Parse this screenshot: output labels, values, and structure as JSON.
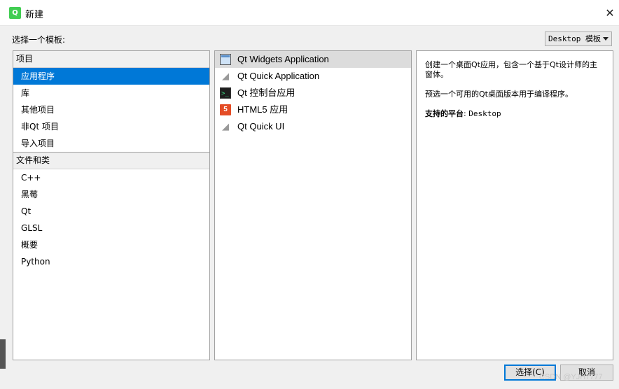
{
  "window": {
    "title": "新建"
  },
  "header": {
    "choose_template_label": "选择一个模板:"
  },
  "platform_combo": {
    "value": "Desktop 模板"
  },
  "categories": {
    "projects_header": "项目",
    "projects": [
      "应用程序",
      "库",
      "其他项目",
      "非Qt 项目",
      "导入项目"
    ],
    "files_header": "文件和类",
    "files": [
      "C++",
      "黑莓",
      "Qt",
      "GLSL",
      "概要",
      "Python"
    ]
  },
  "templates": [
    {
      "label": "Qt Widgets Application",
      "icon": "widgets-window-icon"
    },
    {
      "label": "Qt Quick Application",
      "icon": "qt-quick-icon"
    },
    {
      "label": "Qt 控制台应用",
      "icon": "console-icon"
    },
    {
      "label": "HTML5 应用",
      "icon": "html5-icon"
    },
    {
      "label": "Qt Quick UI",
      "icon": "qt-quick-icon"
    }
  ],
  "description": {
    "line1": "创建一个桌面Qt应用，包含一个基于Qt设计师的主窗体。",
    "line2": "预选一个可用的Qt桌面版本用于编译程序。",
    "platform_label": "支持的平台",
    "platform_value": "Desktop"
  },
  "buttons": {
    "ok": "选择(C)",
    "cancel": "取消"
  },
  "watermark": "CSDN @YJH7777",
  "colors": {
    "selection": "#0078d7",
    "qt_green": "#41cd52",
    "html5": "#e44d26"
  }
}
